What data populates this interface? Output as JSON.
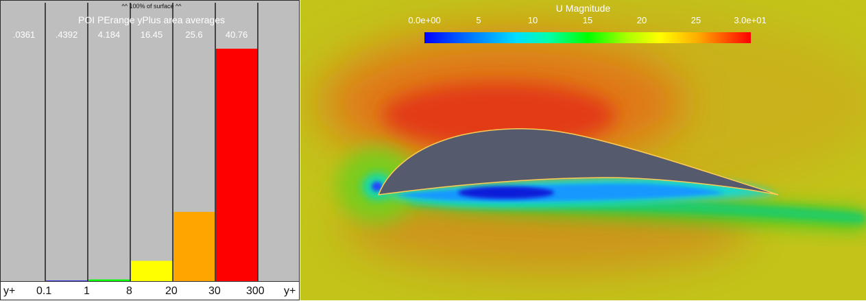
{
  "histogram": {
    "surface_note": "^^ 100% of surface ^^",
    "title": "POI PErange yPlus area averages",
    "axis_end_label_left": "y+",
    "axis_end_label_right": "y+",
    "bin_values": [
      ".0361",
      ".4392",
      "4.184",
      "16.45",
      "25.6",
      "40.76"
    ],
    "bin_edges": [
      "0.1",
      "1",
      "8",
      "20",
      "30",
      "300"
    ],
    "bar_colors": [
      "#0000ff",
      "#0000ff",
      "#00ff00",
      "#ffff00",
      "#ffa500",
      "#ff0000",
      "#bebebe"
    ]
  },
  "chart_data": {
    "type": "bar",
    "title": "POI PErange yPlus area averages",
    "xlabel": "y+",
    "ylabel": "",
    "categories": [
      "<0.1",
      "0.1-1",
      "1-8",
      "8-20",
      "20-30",
      "30-300",
      ">300"
    ],
    "values": [
      0,
      0.005,
      0.01,
      0.09,
      0.3,
      1.0,
      0
    ],
    "ylim": [
      0,
      1.0
    ],
    "bin_averages": [
      0.0361,
      0.4392,
      4.184,
      16.45,
      25.6,
      40.76
    ]
  },
  "colorbar": {
    "title": "U Magnitude",
    "tick_labels": [
      "0.0e+00",
      "5",
      "10",
      "15",
      "20",
      "25",
      "3.0e+01"
    ],
    "range": [
      0,
      30
    ],
    "colors": [
      "#0000ff",
      "#00ddff",
      "#00ff00",
      "#ffff00",
      "#ff0000"
    ]
  }
}
